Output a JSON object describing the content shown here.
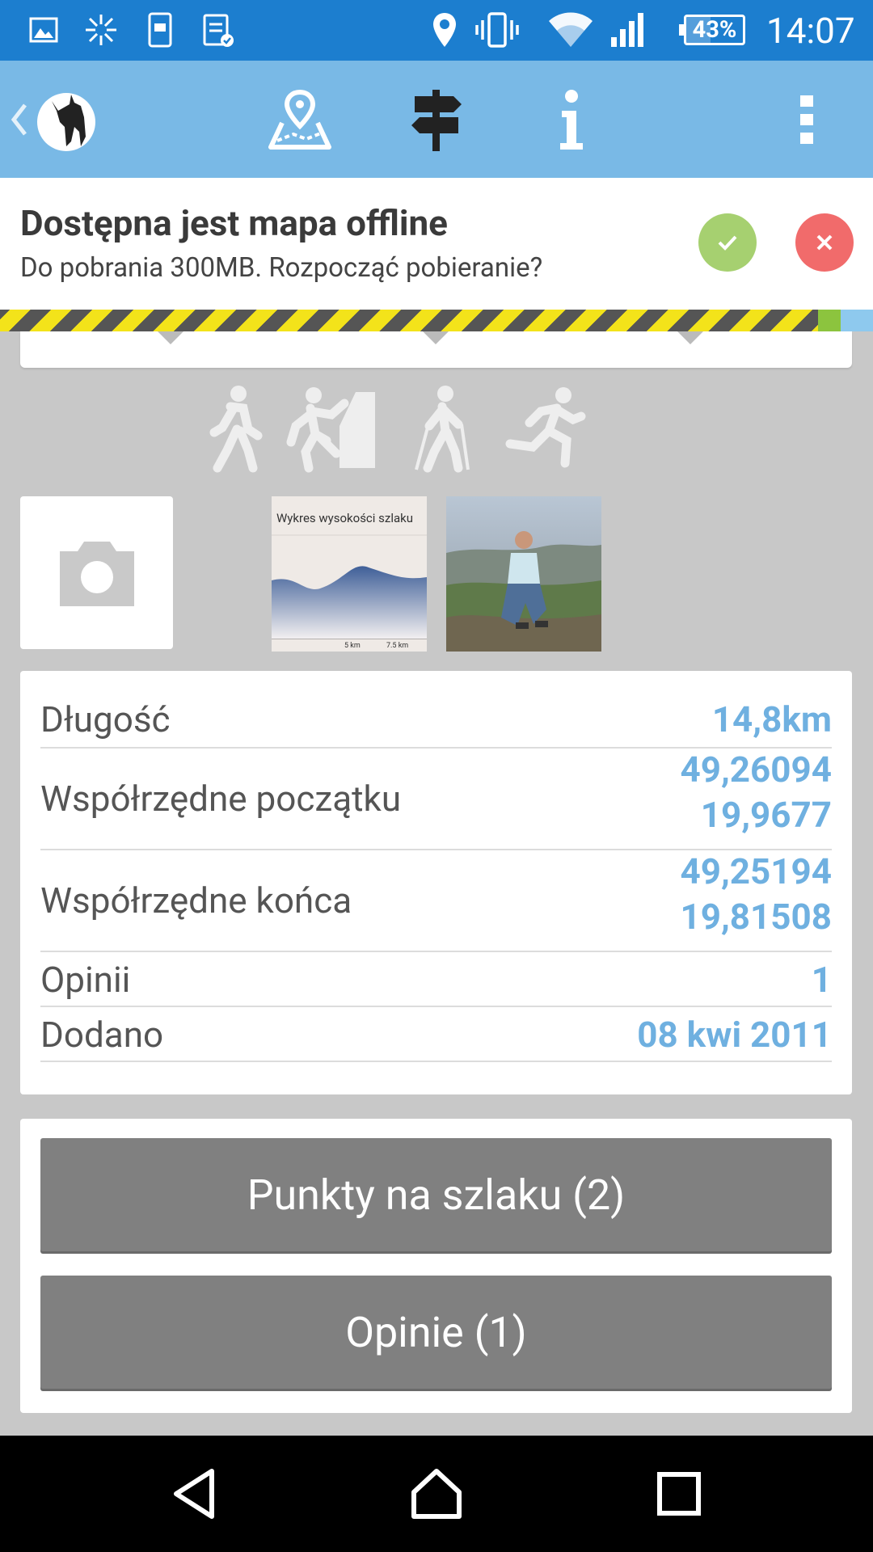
{
  "status_bar": {
    "battery": "43%",
    "time": "14:07",
    "icons": [
      "image-icon",
      "sparkle-icon",
      "phone-card-icon",
      "clipboard-check-icon",
      "location-icon",
      "vibrate-icon",
      "wifi-icon",
      "signal-icon"
    ]
  },
  "app_bar": {
    "icons": [
      "back-chevron-icon",
      "app-logo",
      "map-icon",
      "signpost-icon",
      "info-icon",
      "overflow-menu-icon"
    ]
  },
  "banner": {
    "title": "Dostępna jest mapa offline",
    "subtitle": "Do pobrania 300MB. Rozpocząć pobieranie?",
    "ok_color": "#a6d070",
    "close_color": "#f16b6b"
  },
  "activities": [
    "walking-icon",
    "climbing-icon",
    "nordic-walking-icon",
    "running-icon"
  ],
  "media": {
    "chart_thumb_title": "Wykres wysokości szlaku",
    "chart_thumb_label_1": "5 km",
    "chart_thumb_label_2": "7.5 km"
  },
  "details": [
    {
      "label": "Długość",
      "value": "14,8km"
    },
    {
      "label": "Współrzędne początku",
      "value_line1": "49,26094",
      "value_line2": "19,9677"
    },
    {
      "label": "Współrzędne końca",
      "value_line1": "49,25194",
      "value_line2": "19,81508"
    },
    {
      "label": "Opinii",
      "value": "1"
    },
    {
      "label": "Dodano",
      "value": "08 kwi 2011"
    }
  ],
  "buttons": {
    "points": "Punkty na szlaku (2)",
    "opinions": "Opinie (1)"
  },
  "colors": {
    "status_bar": "#1c7ecf",
    "app_bar": "#79b9e6",
    "value_text": "#6fb0e0",
    "button_bg": "#808080"
  }
}
